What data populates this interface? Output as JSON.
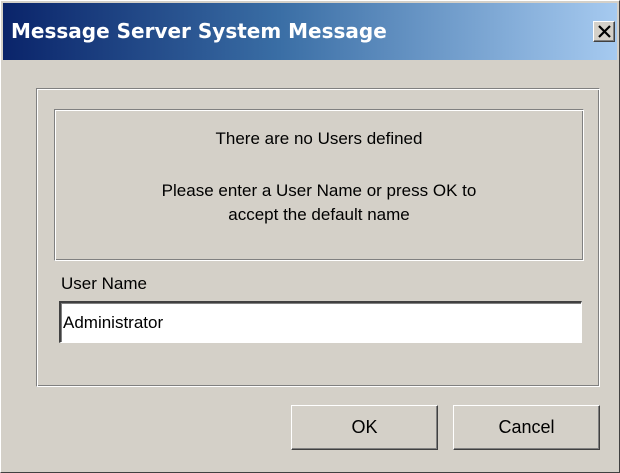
{
  "window": {
    "title": "Message Server System Message",
    "close_icon": "close-icon"
  },
  "message": {
    "line1": "There are no Users defined",
    "line2a": "Please enter a User Name or press OK to",
    "line2b": "accept the default name"
  },
  "user_name": {
    "label": "User Name",
    "value": "Administrator"
  },
  "buttons": {
    "ok": "OK",
    "cancel": "Cancel"
  },
  "colors": {
    "titlebar_start": "#0a246a",
    "titlebar_end": "#a6caf0",
    "dialog_bg": "#d4d0c8"
  }
}
